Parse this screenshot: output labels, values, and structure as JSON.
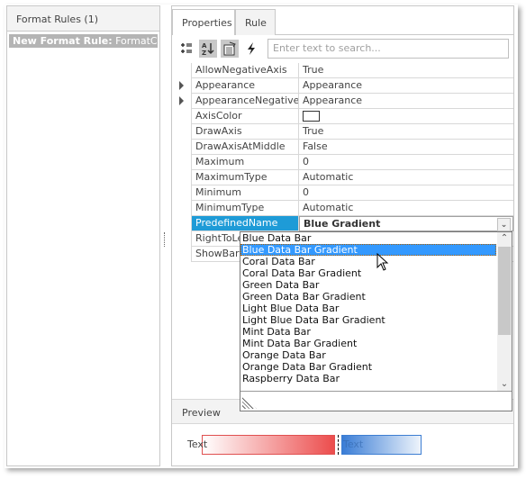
{
  "left_panel": {
    "header": "Format Rules (1)",
    "rule_item": {
      "bold": "New Format Rule:",
      "rest": " FormatCon"
    }
  },
  "tabs": [
    {
      "label": "Properties"
    },
    {
      "label": "Rule"
    }
  ],
  "active_tab": "Rule",
  "toolbar": {
    "categorized_icon": "categorized-list-icon",
    "alphabetical_icon": "sort-az-icon",
    "property_pages_icon": "property-pages-icon",
    "events_icon": "lightning-icon",
    "search_placeholder": "Enter text to search..."
  },
  "properties": [
    {
      "name": "AllowNegativeAxis",
      "value": "True",
      "expandable": false
    },
    {
      "name": "Appearance",
      "value": "Appearance",
      "expandable": true
    },
    {
      "name": "AppearanceNegative",
      "value": "Appearance",
      "expandable": true
    },
    {
      "name": "AxisColor",
      "value": "",
      "expandable": false,
      "color_swatch": "#ffffff"
    },
    {
      "name": "DrawAxis",
      "value": "True",
      "expandable": false
    },
    {
      "name": "DrawAxisAtMiddle",
      "value": "False",
      "expandable": false
    },
    {
      "name": "Maximum",
      "value": "0",
      "expandable": false
    },
    {
      "name": "MaximumType",
      "value": "Automatic",
      "expandable": false
    },
    {
      "name": "Minimum",
      "value": "0",
      "expandable": false
    },
    {
      "name": "MinimumType",
      "value": "Automatic",
      "expandable": false
    },
    {
      "name": "PredefinedName",
      "value": "Blue Gradient",
      "expandable": false,
      "selected": true
    },
    {
      "name": "RightToLeft",
      "value": "",
      "expandable": false
    },
    {
      "name": "ShowBarOnly",
      "value": "",
      "expandable": false
    }
  ],
  "dropdown": {
    "items": [
      "Blue Data Bar",
      "Blue Data Bar Gradient",
      "Coral Data Bar",
      "Coral Data Bar Gradient",
      "Green Data Bar",
      "Green Data Bar Gradient",
      "Light Blue Data Bar",
      "Light Blue Data Bar Gradient",
      "Mint Data Bar",
      "Mint Data Bar Gradient",
      "Orange Data Bar",
      "Orange Data Bar Gradient",
      "Raspberry Data Bar"
    ],
    "highlighted_index": 1
  },
  "preview": {
    "header": "Preview",
    "negative_text": "Text",
    "positive_text": "Text",
    "negative_color": "#ec4d4d",
    "positive_color": "#3a7dd6"
  },
  "colors": {
    "selection": "#1e9bd7",
    "highlight": "#3399ff"
  }
}
